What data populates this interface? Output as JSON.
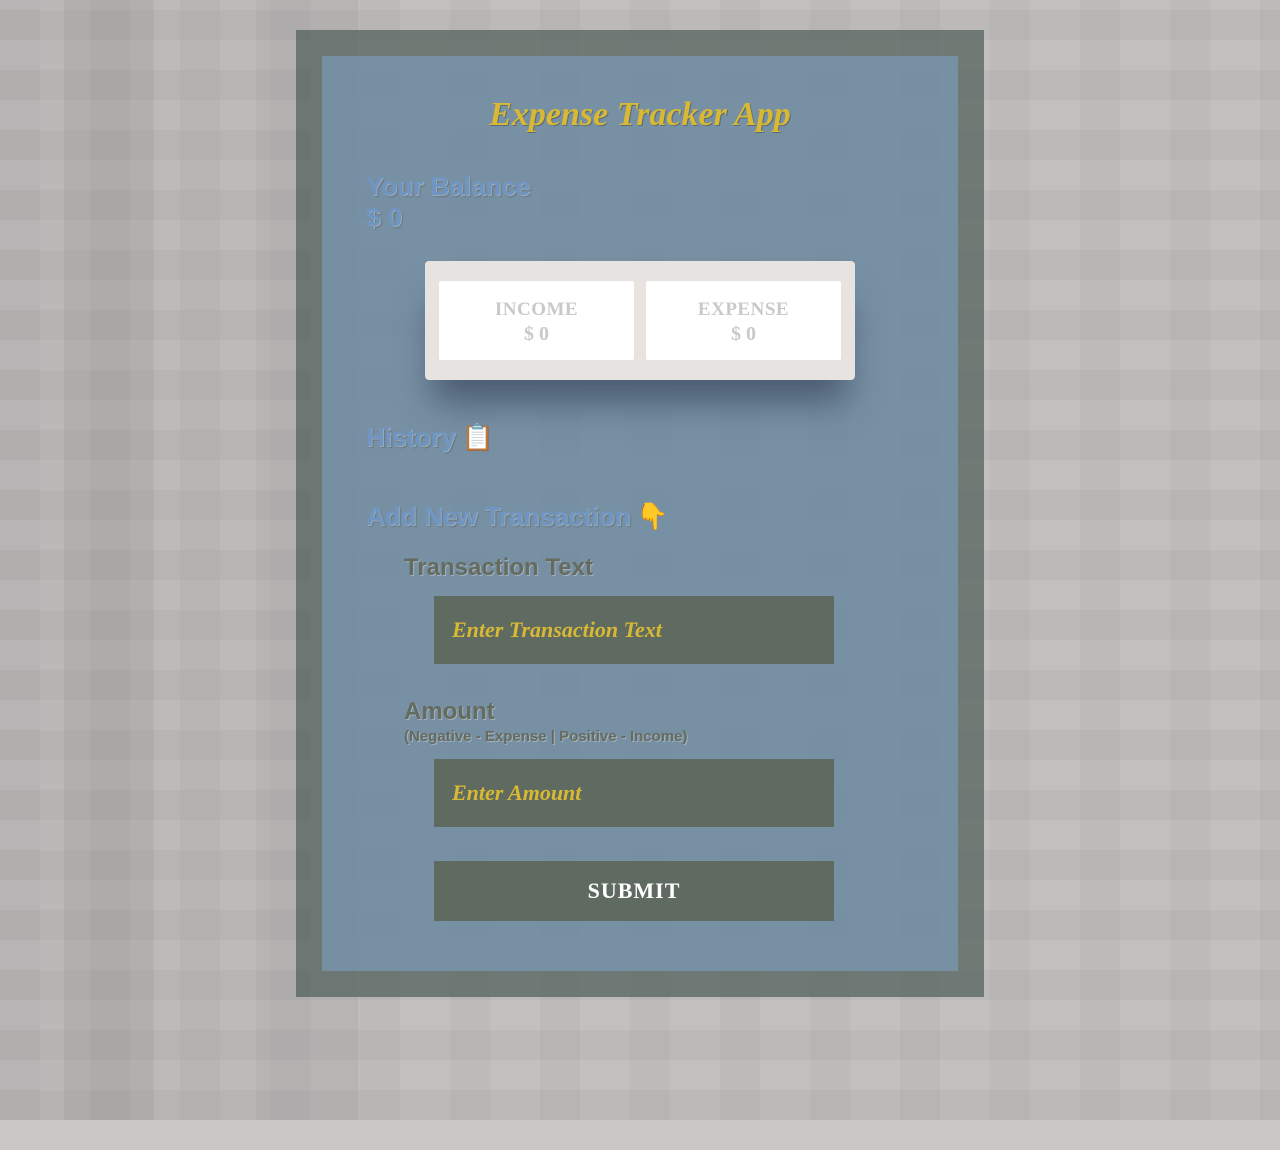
{
  "app": {
    "title": "Expense Tracker App"
  },
  "balance": {
    "label": "Your Balance",
    "amount": "$ 0"
  },
  "summary": {
    "income": {
      "label": "INCOME",
      "value": "$ 0"
    },
    "expense": {
      "label": "EXPENSE",
      "value": "$ 0"
    }
  },
  "history": {
    "heading": "History",
    "icon": "📋"
  },
  "add": {
    "heading": "Add New Transaction",
    "icon": "👇"
  },
  "form": {
    "text_label": "Transaction Text",
    "text_placeholder": "Enter Transaction Text",
    "amount_label": "Amount",
    "amount_hint": "(Negative - Expense | Positive - Income)",
    "amount_placeholder": "Enter Amount",
    "submit_label": "SUBMIT"
  }
}
